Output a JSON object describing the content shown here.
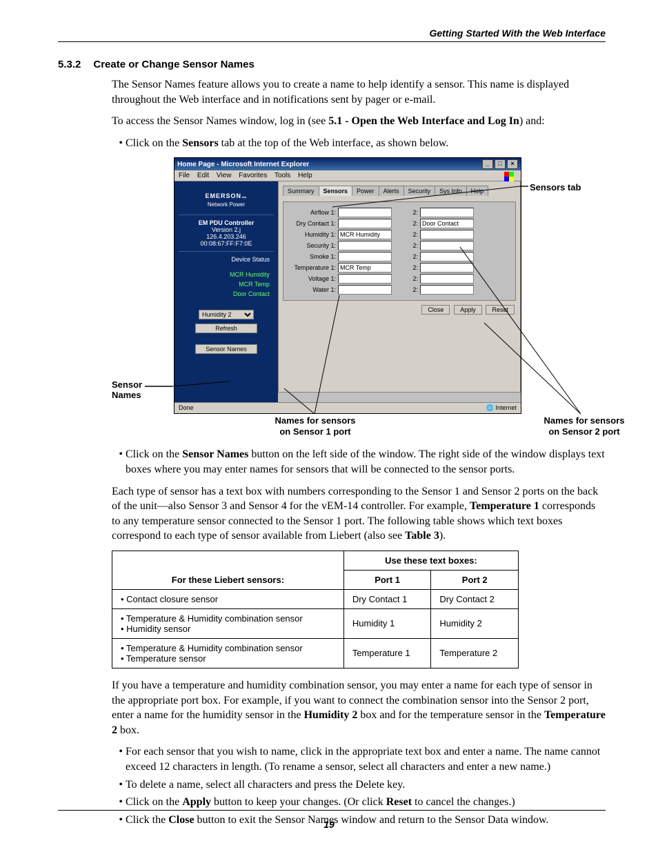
{
  "running_head": "Getting Started With the Web Interface",
  "section_number": "5.3.2",
  "section_title": "Create or Change Sensor Names",
  "paras": {
    "p1": "The Sensor Names feature allows you to create a name to help identify a sensor. This name is displayed throughout the Web interface and in notifications sent by pager or e-mail.",
    "p2_a": "To access the Sensor Names window, log in (see ",
    "p2_b": "5.1 - Open the Web Interface and Log In",
    "p2_c": ") and:",
    "b1_a": "Click on the ",
    "b1_b": "Sensors",
    "b1_c": " tab at the top of the Web interface, as shown below.",
    "b2_a": "Click on the ",
    "b2_b": "Sensor Names",
    "b2_c": " button on the left side of the window. The right side of the window displays text boxes where you may enter names for sensors that will be connected to the sensor ports.",
    "p3_a": "Each type of sensor has a text box with numbers corresponding to the Sensor 1 and Sensor 2 ports on the back of the unit—also Sensor 3 and Sensor 4 for the vEM-14 controller. For example, ",
    "p3_b": "Temperature 1",
    "p3_c": " corresponds to any temperature sensor connected to the Sensor 1 port. The following table shows which text boxes correspond to each type of sensor available from Liebert (also see ",
    "p3_d": "Table 3",
    "p3_e": ").",
    "p4_a": "If you have a temperature and humidity combination sensor, you may enter a name for each type of sensor in the appropriate port box. For example, if you want to connect the combination sensor into the Sensor 2 port, enter a name for the humidity sensor in the ",
    "p4_b": "Humidity 2",
    "p4_c": " box and for the temperature sensor in the ",
    "p4_d": "Temperature 2",
    "p4_e": " box.",
    "b3": "For each sensor that you wish to name, click in the appropriate text box and enter a name. The name cannot exceed 12 characters in length. (To rename a sensor, select all characters and enter a new name.)",
    "b4": "To delete a name, select all characters and press the Delete key.",
    "b5_a": "Click on the ",
    "b5_b": "Apply",
    "b5_c": " button to keep your changes. (Or click ",
    "b5_d": "Reset",
    "b5_e": " to cancel the changes.)",
    "b6_a": "Click the ",
    "b6_b": "Close",
    "b6_c": " button to exit the Sensor Names window and return to the Sensor Data window."
  },
  "callouts": {
    "sensors_tab": "Sensors tab",
    "sensor_names": "Sensor\nNames",
    "names1": "Names for sensors\non Sensor 1 port",
    "names2": "Names for sensors\non Sensor 2 port"
  },
  "ie": {
    "title": "Home Page - Microsoft Internet Explorer",
    "menus": [
      "File",
      "Edit",
      "View",
      "Favorites",
      "Tools",
      "Help"
    ],
    "brand": "EMERSON",
    "brand_tm": "™",
    "brand_sub": "Network Power",
    "tabs": [
      "Summary",
      "Sensors",
      "Power",
      "Alerts",
      "Security",
      "Sys Info",
      "Help"
    ],
    "active_tab_index": 1,
    "sidebar": {
      "title": "EM PDU Controller",
      "version": "Version 2.j",
      "ip": "126.4.203.246",
      "mac": "00:08:67:FF:F7:0E",
      "device_status_label": "Device Status",
      "status_items": [
        "MCR Humidity",
        "MCR Temp",
        "Door Contact"
      ],
      "select_value": "Humidity 2",
      "refresh": "Refresh",
      "sensor_names_btn": "Sensor Names"
    },
    "labels1": [
      "Airflow 1:",
      "Dry Contact 1:",
      "Humidity 1:",
      "Security 1:",
      "Smoke 1:",
      "Temperature 1:",
      "Voltage 1:",
      "Water 1:"
    ],
    "values1": [
      "",
      "",
      "MCR Humidity",
      "",
      "",
      "MCR Temp",
      "",
      ""
    ],
    "labels2": [
      "2:",
      "2:",
      "2:",
      "2:",
      "2:",
      "2:",
      "2:",
      "2:"
    ],
    "values2": [
      "",
      "Door Contact",
      "",
      "",
      "",
      "",
      "",
      ""
    ],
    "buttons": [
      "Close",
      "Apply",
      "Reset"
    ],
    "status_left": "Done",
    "status_right": "Internet"
  },
  "table": {
    "head": {
      "merge": "Use these text boxes:",
      "c1": "For these Liebert sensors:",
      "c2": "Port 1",
      "c3": "Port 2"
    },
    "rows": [
      {
        "c1": "• Contact closure sensor",
        "c2": "Dry Contact 1",
        "c3": "Dry Contact 2"
      },
      {
        "c1": "• Temperature & Humidity combination sensor\n• Humidity sensor",
        "c2": "Humidity 1",
        "c3": "Humidity 2"
      },
      {
        "c1": "• Temperature & Humidity combination sensor\n• Temperature sensor",
        "c2": "Temperature 1",
        "c3": "Temperature 2"
      }
    ]
  },
  "page_number": "19"
}
